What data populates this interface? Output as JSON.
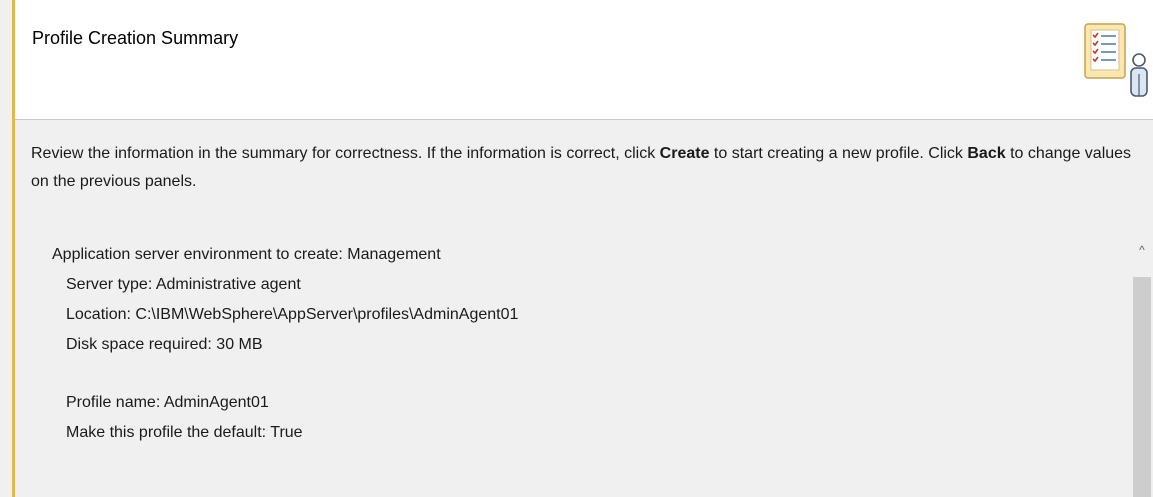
{
  "header": {
    "title": "Profile Creation Summary",
    "icon": "checklist-user-icon"
  },
  "intro": {
    "part1": "Review the information in the summary for correctness. If the information is correct, click ",
    "create_label": "Create",
    "part2": " to start creating a new profile. Click ",
    "back_label": "Back",
    "part3": " to change values on the previous panels."
  },
  "summary": {
    "environment": "Application server environment to create: Management",
    "server_type": "Server type: Administrative agent",
    "location": "Location: C:\\IBM\\WebSphere\\AppServer\\profiles\\AdminAgent01",
    "disk_space": "Disk space required: 30 MB",
    "profile_name": "Profile name: AdminAgent01",
    "default_profile": "Make this profile the default: True"
  },
  "scrollbar": {
    "up_arrow": "^"
  },
  "colors": {
    "accent": "#e1b84e",
    "header_bg": "#ffffff",
    "panel_bg": "#f0f0f0"
  }
}
